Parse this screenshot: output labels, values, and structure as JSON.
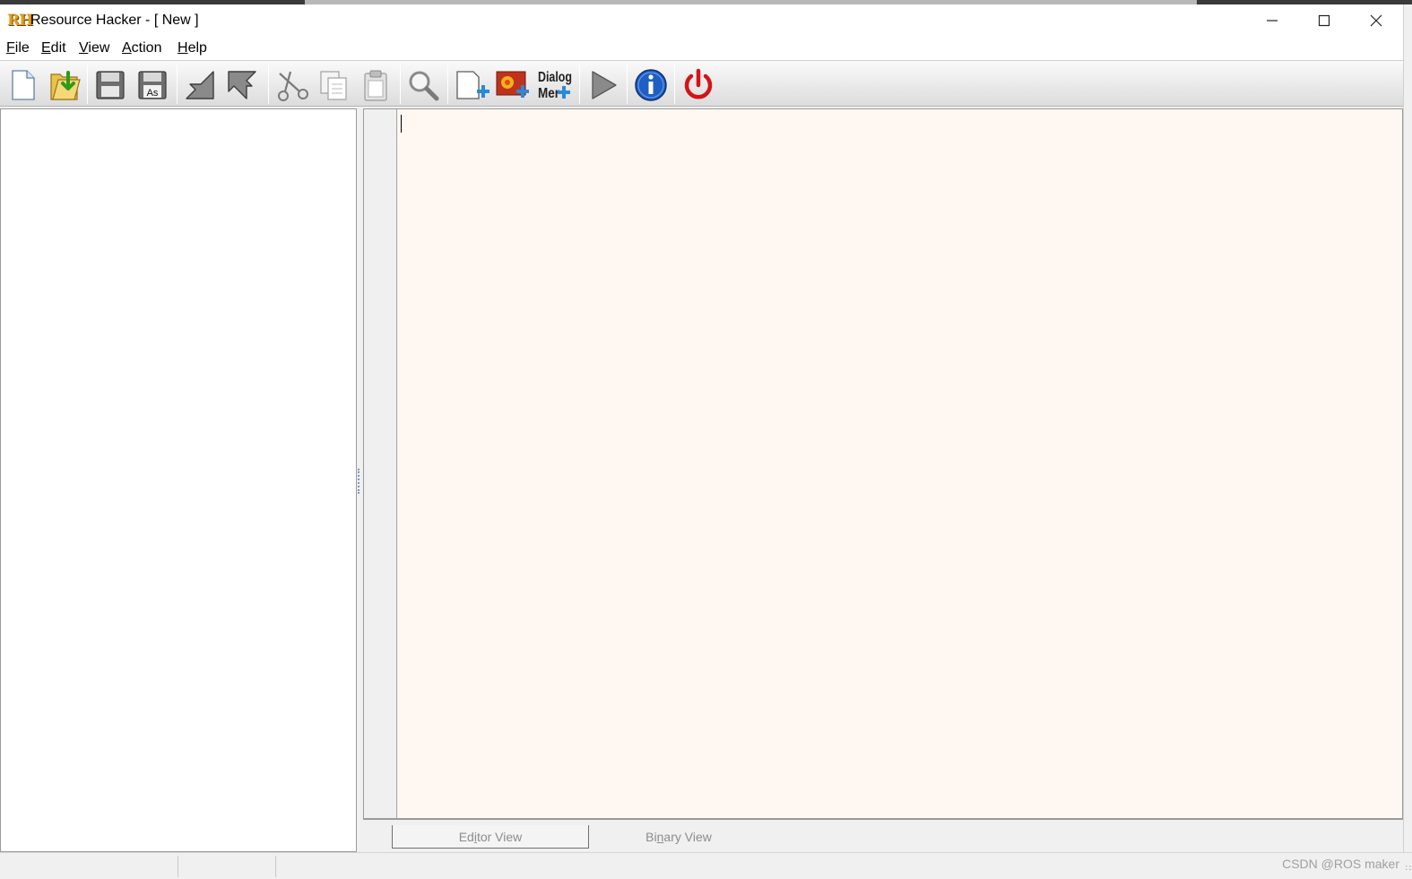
{
  "window": {
    "logo": "RH",
    "title": "Resource Hacker - [ New ]",
    "minimize_icon": "minimize-icon",
    "maximize_icon": "maximize-icon",
    "close_icon": "close-icon"
  },
  "menubar": {
    "items": [
      {
        "key": "F",
        "rest": "ile"
      },
      {
        "key": "E",
        "rest": "dit"
      },
      {
        "key": "V",
        "rest": "iew"
      },
      {
        "key": "A",
        "rest": "ction"
      },
      {
        "key": "H",
        "rest": "elp"
      }
    ]
  },
  "toolbar": {
    "dialog_menu_label_top": "Dialog",
    "dialog_menu_label_bottom": "Mer",
    "save_as_label": "As",
    "icons": [
      "new-file-icon",
      "open-file-icon",
      "save-icon",
      "save-as-icon",
      "import-icon",
      "export-icon",
      "cut-icon",
      "copy-icon",
      "paste-icon",
      "find-icon",
      "add-blank-resource-icon",
      "add-image-resource-icon",
      "dialog-menu-add-icon",
      "compile-run-icon",
      "about-info-icon",
      "exit-power-icon"
    ]
  },
  "tabs": {
    "editor": {
      "pre": "Ed",
      "key": "i",
      "post": "tor View"
    },
    "binary": {
      "pre": "Bi",
      "key": "n",
      "post": "ary View"
    }
  },
  "statusbar": {
    "watermark": "CSDN @ROS maker",
    "sizegrip": "∷"
  },
  "colors": {
    "editor_background": "#fff8f2",
    "power_red": "#d41414",
    "info_blue": "#1f5fc4",
    "add_blue": "#2a8ad8"
  }
}
